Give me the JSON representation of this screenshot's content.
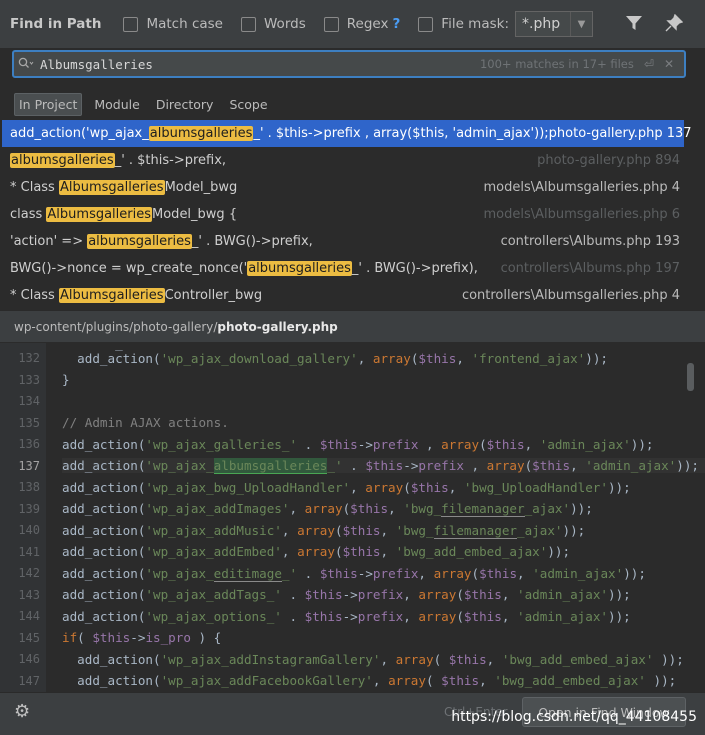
{
  "header": {
    "title": "Find in Path",
    "match_case": "Match case",
    "words": "Words",
    "regex": "Regex",
    "regex_help": "?",
    "file_mask": "File mask:",
    "file_mask_value": "*.php"
  },
  "search": {
    "query": "Albumsgalleries",
    "match_count": "100+ matches in 17+ files"
  },
  "scope_tabs": [
    "In Project",
    "Module",
    "Directory",
    "Scope"
  ],
  "results": [
    {
      "parts": [
        {
          "t": "add_action('wp_ajax_",
          "h": false
        },
        {
          "t": "albumsgalleries",
          "h": true
        },
        {
          "t": "_' . $this->prefix , array($this, 'admin_ajax'));",
          "h": false
        }
      ],
      "location": "photo-gallery.php 137",
      "selected": true,
      "dim": false
    },
    {
      "parts": [
        {
          "t": "albumsgalleries",
          "h": true
        },
        {
          "t": "_' . $this->prefix,",
          "h": false
        }
      ],
      "location": "photo-gallery.php 894",
      "selected": false,
      "dim": true
    },
    {
      "parts": [
        {
          "t": "* Class ",
          "h": false
        },
        {
          "t": "Albumsgalleries",
          "h": true
        },
        {
          "t": "Model_bwg",
          "h": false
        }
      ],
      "location": "models\\Albumsgalleries.php 4",
      "selected": false,
      "dim": false
    },
    {
      "parts": [
        {
          "t": "class ",
          "h": false
        },
        {
          "t": "Albumsgalleries",
          "h": true
        },
        {
          "t": "Model_bwg {",
          "h": false
        }
      ],
      "location": "models\\Albumsgalleries.php 6",
      "selected": false,
      "dim": true
    },
    {
      "parts": [
        {
          "t": "'action' => ",
          "h": false
        },
        {
          "t": "albumsgalleries",
          "h": true
        },
        {
          "t": "_' . BWG()->prefix,",
          "h": false
        }
      ],
      "location": "controllers\\Albums.php 193",
      "selected": false,
      "dim": false
    },
    {
      "parts": [
        {
          "t": "BWG()->nonce = wp_create_nonce('",
          "h": false
        },
        {
          "t": "albumsgalleries",
          "h": true
        },
        {
          "t": "_' . BWG()->prefix),",
          "h": false
        }
      ],
      "location": "controllers\\Albums.php 197",
      "selected": false,
      "dim": true
    },
    {
      "parts": [
        {
          "t": "* Class ",
          "h": false
        },
        {
          "t": "Albumsgalleries",
          "h": true
        },
        {
          "t": "Controller_bwg",
          "h": false
        }
      ],
      "location": "controllers\\Albumsgalleries.php 4",
      "selected": false,
      "dim": false
    }
  ],
  "path": {
    "dir": "wp-content/plugins/photo-gallery/",
    "file": "photo-gallery.php"
  },
  "editor": {
    "line_numbers": [
      "132",
      "133",
      "134",
      "135",
      "136",
      "137",
      "138",
      "139",
      "140",
      "141",
      "142",
      "143",
      "144",
      "145",
      "146",
      "147"
    ],
    "current_line": "137"
  },
  "footer": {
    "shortcut_hint": "Ctrl+Enter",
    "open_button": "Open in Find Window",
    "watermark": "https://blog.csdn.net/qq_44108455"
  },
  "icons": {
    "filter": "filter-icon",
    "pin": "pin-icon",
    "search": "magnifier-icon",
    "settings": "gear-icon"
  }
}
